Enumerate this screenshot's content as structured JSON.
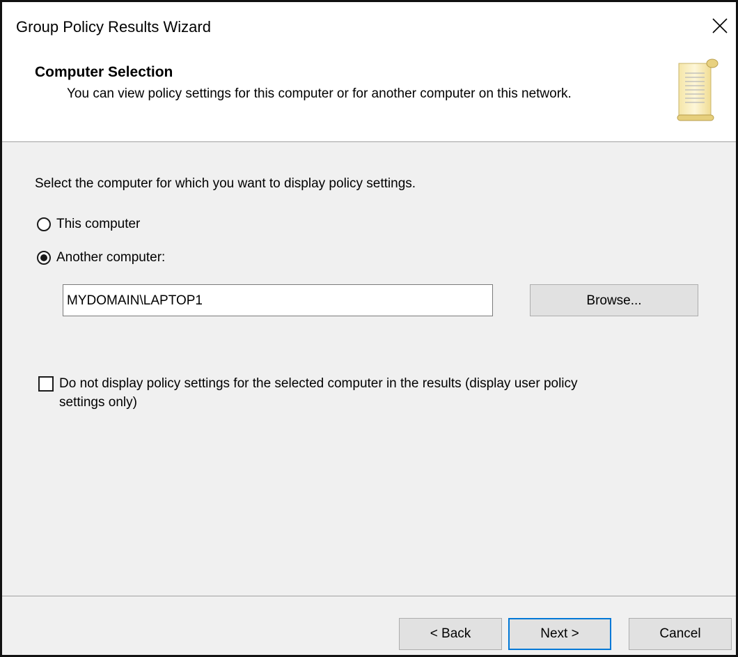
{
  "window": {
    "title": "Group Policy Results Wizard"
  },
  "header": {
    "title": "Computer Selection",
    "subtitle": "You can view policy settings for this computer or for another computer on this network.",
    "icon": "scroll-icon"
  },
  "main": {
    "instruction": "Select the computer for which you want to display policy settings.",
    "options": [
      {
        "label": "This computer",
        "selected": false
      },
      {
        "label": "Another computer:",
        "selected": true
      }
    ],
    "computer_name_value": "MYDOMAIN\\LAPTOP1",
    "browse_label": "Browse...",
    "checkbox": {
      "line1": "Do not display policy settings for the selected computer in the results (display user policy",
      "line2": "settings only)",
      "checked": false
    }
  },
  "footer": {
    "back_label": "< Back",
    "next_label": "Next >",
    "cancel_label": "Cancel"
  },
  "colors": {
    "dialog_bg": "#f0f0f0",
    "header_bg": "#ffffff",
    "default_button_border": "#0078d7",
    "button_bg": "#e1e1e1"
  }
}
